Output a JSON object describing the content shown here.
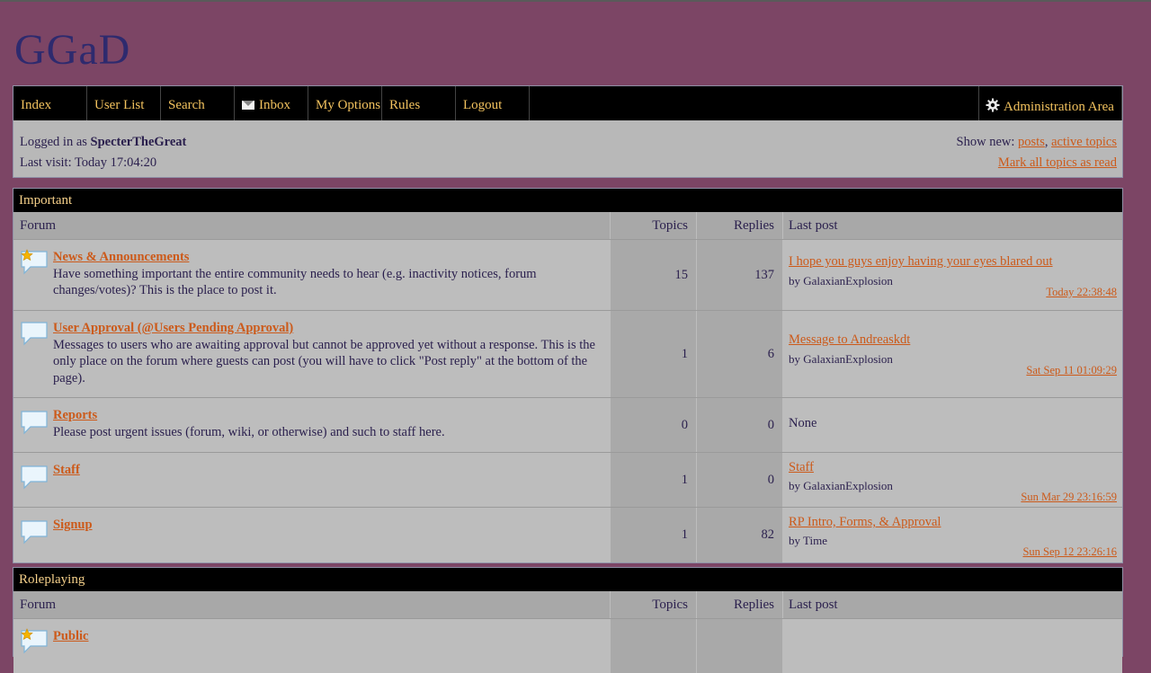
{
  "site": {
    "title": "GGaD"
  },
  "nav": {
    "items": [
      "Index",
      "User List",
      "Search",
      "Inbox",
      "My Options",
      "Rules",
      "Logout"
    ],
    "admin": "Administration Area"
  },
  "status": {
    "logged_in_prefix": "Logged in as",
    "username": "SpecterTheGreat",
    "last_visit": "Last visit: Today 17:04:20",
    "show_new_prefix": "Show new:",
    "posts_link": "posts",
    "comma": ",",
    "active_topics_link": "active topics",
    "mark_read_link": "Mark all topics as read"
  },
  "columns": {
    "forum": "Forum",
    "topics": "Topics",
    "replies": "Replies",
    "last_post": "Last post"
  },
  "categories": [
    {
      "name": "Important",
      "forums": [
        {
          "title": "News & Announcements",
          "desc": "Have something important the entire community needs to hear (e.g. inactivity notices, forum changes/votes)? This is the place to post it.",
          "topics": "15",
          "replies": "137",
          "last_title": "I hope you guys enjoy having your eyes blared out",
          "last_by": "by GalaxianExplosion",
          "last_time": "Today 22:38:48",
          "new": true
        },
        {
          "title": "User Approval (@Users Pending Approval)",
          "desc": "Messages to users who are awaiting approval but cannot be approved yet without a response. This is the only place on the forum where guests can post (you will have to click \"Post reply\" at the bottom of the page).",
          "topics": "1",
          "replies": "6",
          "last_title": "Message to Andreaskdt",
          "last_by": "by GalaxianExplosion",
          "last_time": "Sat Sep 11 01:09:29",
          "new": false
        },
        {
          "title": "Reports",
          "desc": "Please post urgent issues (forum, wiki, or otherwise) and such to staff here.",
          "topics": "0",
          "replies": "0",
          "last_none": "None",
          "new": false
        },
        {
          "title": "Staff",
          "desc": "",
          "topics": "1",
          "replies": "0",
          "last_title": "Staff",
          "last_by": "by GalaxianExplosion",
          "last_time": "Sun Mar 29 23:16:59",
          "new": false
        },
        {
          "title": "Signup",
          "desc": "",
          "topics": "1",
          "replies": "82",
          "last_title": "RP Intro, Forms, & Approval",
          "last_by": "by Time",
          "last_time": "Sun Sep 12 23:26:16",
          "new": false
        }
      ]
    },
    {
      "name": "Roleplaying",
      "forums": [
        {
          "title": "Public",
          "new": true
        }
      ]
    }
  ],
  "colors": {
    "background": "#7c4565",
    "nav_text": "#f2c25e",
    "link": "#cc5a1a",
    "header": "#000000"
  }
}
